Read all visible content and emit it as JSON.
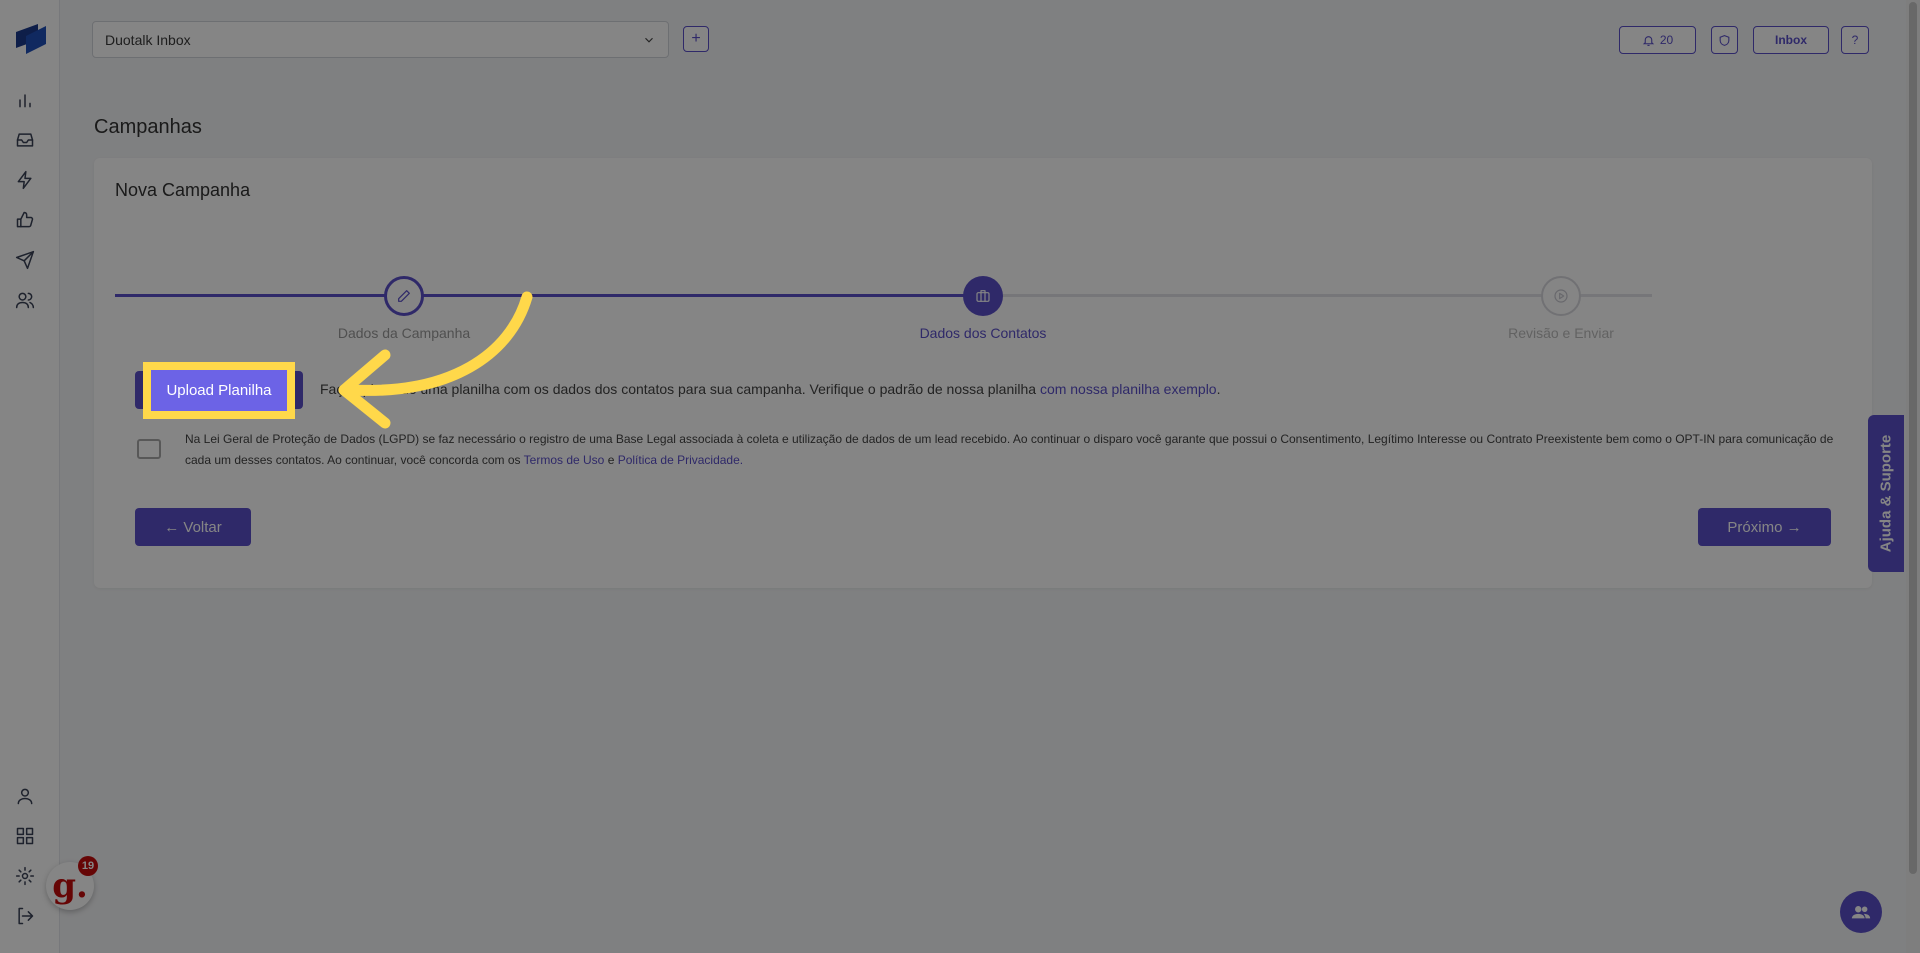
{
  "topbar": {
    "inbox_select": "Duotalk Inbox",
    "add_label": "+",
    "notifications_count": "20",
    "inbox_button": "Inbox",
    "help_button": "?"
  },
  "page": {
    "title": "Campanhas",
    "card_title": "Nova Campanha"
  },
  "steps": [
    {
      "label": "Dados da Campanha",
      "state": "done"
    },
    {
      "label": "Dados dos Contatos",
      "state": "active"
    },
    {
      "label": "Revisão e Enviar",
      "state": "pending"
    }
  ],
  "upload": {
    "button": "Upload Planilha",
    "desc_prefix": "Faça upload de uma planilha com os dados dos contatos para sua campanha. Verifique o padrão de nossa planilha ",
    "desc_link": "com nossa planilha exemplo",
    "desc_suffix": "."
  },
  "lgpd": {
    "text": "Na Lei Geral de Proteção de Dados (LGPD) se faz necessário o registro de uma Base Legal associada à coleta e utilização de dados de um lead recebido. Ao continuar o disparo você garante que possui o Consentimento, Legítimo Interesse ou Contrato Preexistente bem como o OPT-IN para comunicação de cada um desses contatos. Ao continuar, você concorda com os ",
    "terms_link": "Termos de Uso",
    "and": " e ",
    "privacy_link": "Política de Privacidade",
    "end": "."
  },
  "nav": {
    "back": "← Voltar",
    "next": "Próximo →"
  },
  "help_tab": "Ajuda & Suporte",
  "g_badge": {
    "letter": "g.",
    "count": "19"
  },
  "colors": {
    "accent": "#5a4fc9",
    "highlight": "#ffd84a"
  },
  "icons": [
    "chart-icon",
    "inbox-icon",
    "bolt-icon",
    "thumbs-up-icon",
    "send-icon",
    "users-icon",
    "user-icon",
    "grid-icon",
    "settings-icon",
    "logout-icon",
    "bell-icon",
    "shield-icon",
    "chevron-down-icon",
    "edit-icon",
    "briefcase-icon",
    "play-icon",
    "chat-users-icon"
  ]
}
